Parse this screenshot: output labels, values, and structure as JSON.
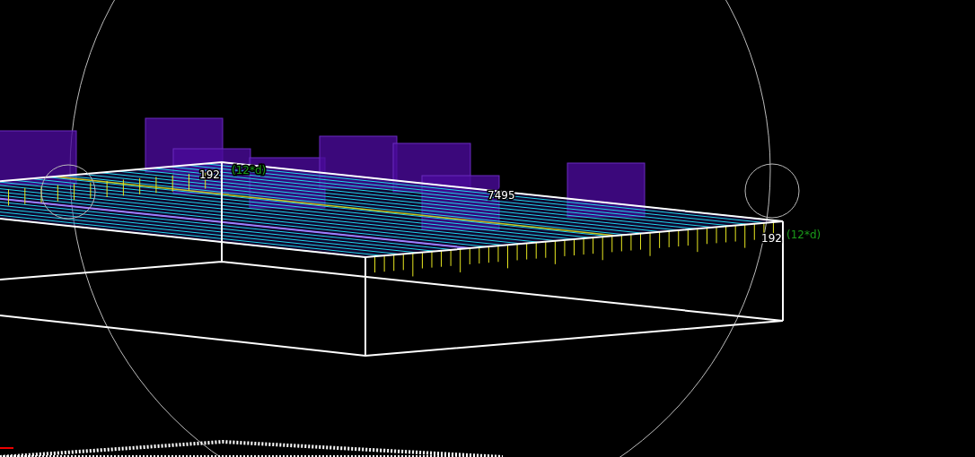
{
  "viewport": {
    "labels": [
      {
        "text": "192",
        "kind": "dimension"
      },
      {
        "text": "(12*d)",
        "kind": "formula"
      },
      {
        "text": "7495",
        "kind": "dimension"
      },
      {
        "text": "192",
        "kind": "dimension"
      },
      {
        "text": "(12*d)",
        "kind": "formula"
      }
    ]
  }
}
